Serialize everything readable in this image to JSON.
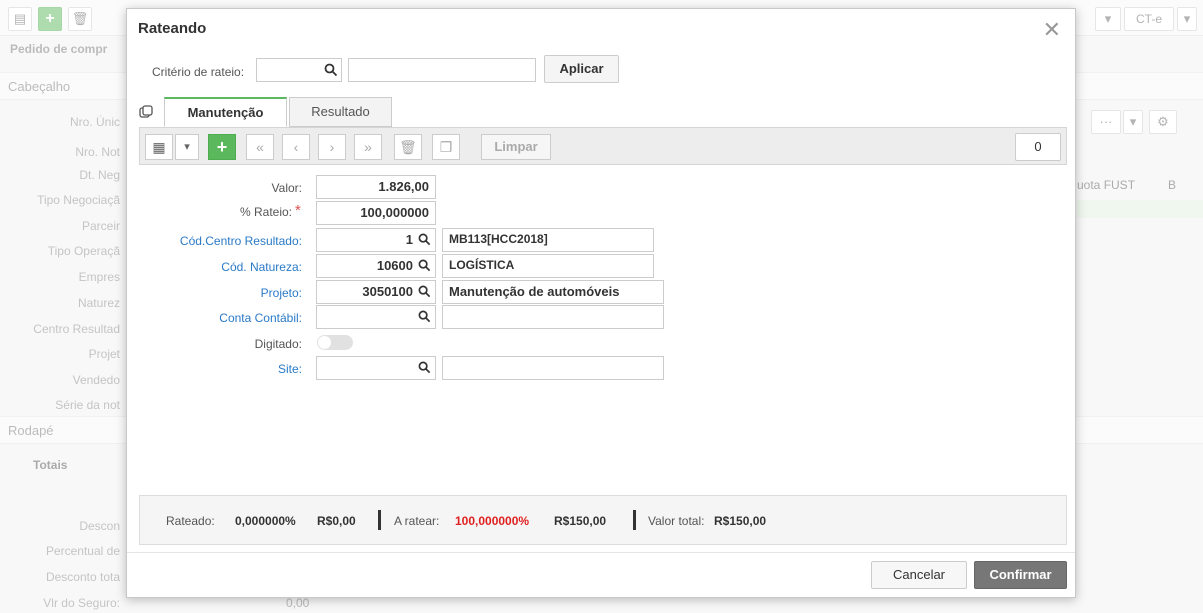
{
  "background": {
    "page_title": "Pedido de compr",
    "header_panel": "Cabeçalho",
    "footer_panel": "Rodapé",
    "totals_tab": "Totais",
    "top_right_value": "CT-e",
    "column_header": "uota FUST",
    "column_header_2": "B",
    "left_labels": [
      "Nro. Únic",
      "Nro. Not",
      "Dt. Neg",
      "Tipo Negociaçã",
      "Parceir",
      "Tipo Operaçã",
      "Empres",
      "Naturez",
      "Centro Resultad",
      "Projet",
      "Vendedo",
      "Série da not"
    ],
    "footer_labels": [
      "Descon",
      "Percentual de",
      "Desconto tota",
      "Vlr do Seguro:"
    ],
    "footer_value": "0,00"
  },
  "modal": {
    "title": "Rateando",
    "criterio_label": "Critério de rateio:",
    "criterio_code": "",
    "criterio_desc": "",
    "apply_button": "Aplicar",
    "tabs": [
      {
        "label": "Manutenção",
        "active": true
      },
      {
        "label": "Resultado",
        "active": false
      }
    ],
    "toolbar": {
      "clear_button": "Limpar",
      "record_count": "0"
    },
    "form": {
      "valor": {
        "label": "Valor:",
        "value": "1.826,00"
      },
      "rateio": {
        "label": "% Rateio:",
        "value": "100,000000",
        "required_mark": "*"
      },
      "centro_resultado": {
        "label": "Cód.Centro Resultado:",
        "code": "1",
        "desc": "MB113[HCC2018]"
      },
      "natureza": {
        "label": "Cód. Natureza:",
        "code": "10600",
        "desc": "LOGÍSTICA"
      },
      "projeto": {
        "label": "Projeto:",
        "code": "3050100",
        "desc": "Manutenção de automóveis"
      },
      "conta_contabil": {
        "label": "Conta Contábil:",
        "code": "",
        "desc": ""
      },
      "digitado": {
        "label": "Digitado:",
        "on": false
      },
      "site": {
        "label": "Site:",
        "code": "",
        "desc": ""
      }
    },
    "summary": {
      "rateado_label": "Rateado:",
      "rateado_pct": "0,000000%",
      "rateado_val": "R$0,00",
      "aratear_label": "A ratear:",
      "aratear_pct": "100,000000%",
      "aratear_val": "R$150,00",
      "total_label": "Valor total:",
      "total_val": "R$150,00"
    },
    "cancel_button": "Cancelar",
    "confirm_button": "Confirmar"
  },
  "colors": {
    "accent_green": "#5cb85c",
    "link_blue": "#2a7ac7",
    "alert_red": "#e02020",
    "confirm_gray": "#777777"
  }
}
